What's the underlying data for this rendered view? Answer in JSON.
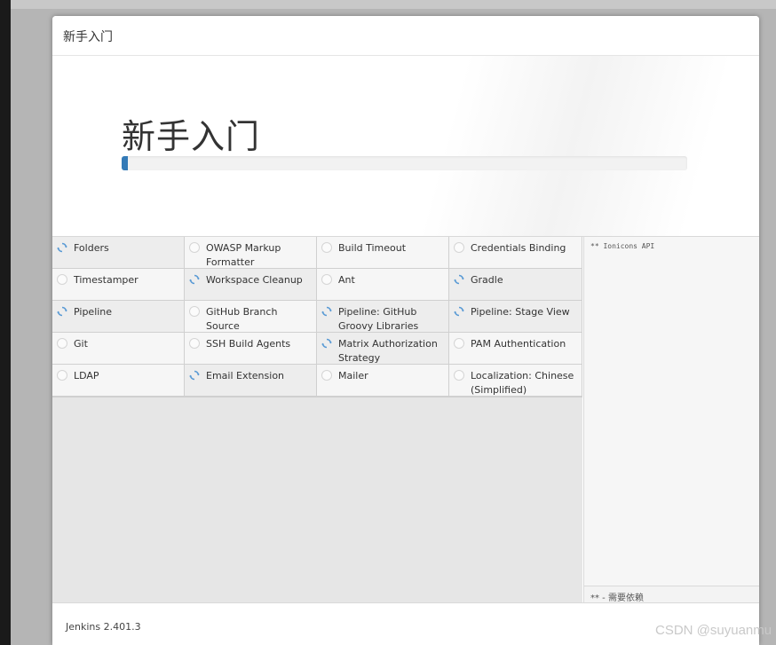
{
  "dialog": {
    "title": "新手入门"
  },
  "hero": {
    "title": "新手入门",
    "progress": 0.01
  },
  "plugins": [
    {
      "name": "Folders",
      "status": "installing"
    },
    {
      "name": "OWASP Markup Formatter",
      "status": "pending"
    },
    {
      "name": "Build Timeout",
      "status": "pending"
    },
    {
      "name": "Credentials Binding",
      "status": "pending"
    },
    {
      "name": "Timestamper",
      "status": "pending"
    },
    {
      "name": "Workspace Cleanup",
      "status": "installing"
    },
    {
      "name": "Ant",
      "status": "pending"
    },
    {
      "name": "Gradle",
      "status": "installing"
    },
    {
      "name": "Pipeline",
      "status": "installing"
    },
    {
      "name": "GitHub Branch Source",
      "status": "pending"
    },
    {
      "name": "Pipeline: GitHub Groovy Libraries",
      "status": "installing"
    },
    {
      "name": "Pipeline: Stage View",
      "status": "installing"
    },
    {
      "name": "Git",
      "status": "pending"
    },
    {
      "name": "SSH Build Agents",
      "status": "pending"
    },
    {
      "name": "Matrix Authorization Strategy",
      "status": "installing"
    },
    {
      "name": "PAM Authentication",
      "status": "pending"
    },
    {
      "name": "LDAP",
      "status": "pending"
    },
    {
      "name": "Email Extension",
      "status": "installing"
    },
    {
      "name": "Mailer",
      "status": "pending"
    },
    {
      "name": "Localization: Chinese (Simplified)",
      "status": "pending"
    }
  ],
  "log": {
    "text": "** Ionicons API",
    "footer": "** - 需要依赖"
  },
  "footer": {
    "version": "Jenkins 2.401.3"
  },
  "watermark": "CSDN @suyuanmu",
  "colors": {
    "progress": "#337ab7",
    "spinner": "#5b9bd5"
  }
}
